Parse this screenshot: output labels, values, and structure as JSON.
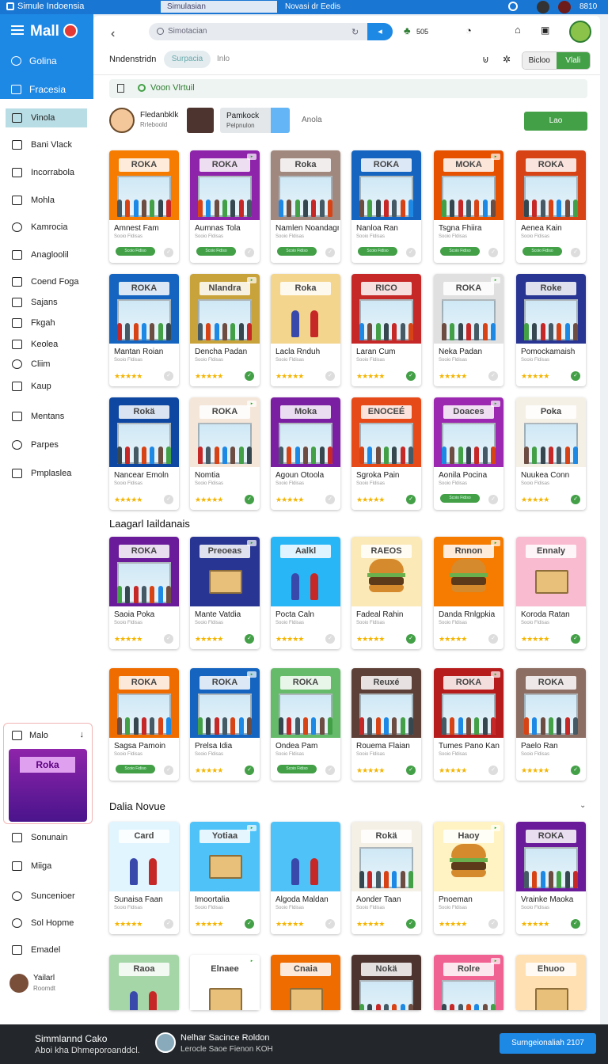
{
  "topbar": {
    "title": "Simule Indoensia",
    "tab_active": "Simulasian",
    "tab_other": "Novasi dr Eedis",
    "value": "8810"
  },
  "sidebar": {
    "logo": "Mall",
    "header_items": [
      "Golina",
      "Fracesia"
    ],
    "items": [
      "Vinola",
      "Bani Vlack",
      "Incorrabola",
      "Mohla",
      "Kamrocia",
      "Anagloolil",
      "Coend Foga",
      "Sajans",
      "Fkgah",
      "Keolea",
      "Cliim",
      "Kaup",
      "Mentans",
      "Parpes",
      "Pmplaslea"
    ],
    "panel_label": "Malo",
    "panel_image_sign": "Roka",
    "items_bottom": [
      "Sonunain",
      "Miiga",
      "Suncenioer",
      "Sol Hopme",
      "Emadel"
    ],
    "user_name": "Yailarl",
    "user_role": "Roomdt"
  },
  "main": {
    "search_placeholder": "Simotacian",
    "top_count": "505",
    "nav_title": "Nndenstridn",
    "nav_chip": "Surpacia",
    "nav_info": "Inlo",
    "seg_left": "Bicloo",
    "seg_right": "Vlali",
    "vbar_text": "Voon Vlrtuil",
    "profile_name": "Fledanbklk",
    "profile_sub": "Rrleboold",
    "box_title": "Pamkock",
    "box_sub": "Pelpnulon",
    "box_label": "Anola",
    "action_button": "Lao",
    "section1": "Laagarl Iaildanais",
    "section2": "Dalia Novue"
  },
  "cards": [
    {
      "title": "Amnest Fam",
      "sign": "ROKA",
      "color": "#f57c00",
      "footer": "pill"
    },
    {
      "title": "Aumnas Tola",
      "sign": "ROKA",
      "color": "#8e24aa",
      "footer": "pill"
    },
    {
      "title": "Namlen Noandagn",
      "sign": "Roka",
      "color": "#a1887f",
      "footer": "pill"
    },
    {
      "title": "Nanloa Ran",
      "sign": "ROKA",
      "color": "#1565c0",
      "footer": "pill"
    },
    {
      "title": "Tsgna Fhiira",
      "sign": "MOKA",
      "color": "#e65100",
      "footer": "pill"
    },
    {
      "title": "Aenea Kain",
      "sign": "ROKA",
      "color": "#d84315",
      "footer": "pill"
    },
    {
      "title": "Mantan Roian",
      "sign": "ROKA",
      "color": "#1565c0",
      "footer": "stars"
    },
    {
      "title": "Dencha Padan",
      "sign": "Nlandra",
      "color": "#c8a23a",
      "footer": "stars"
    },
    {
      "title": "Lacla Rnduh",
      "sign": "Roka",
      "color": "#f4d58d",
      "footer": "stars",
      "kind": "people"
    },
    {
      "title": "Laran Cum",
      "sign": "RICO",
      "color": "#c62828",
      "footer": "stars"
    },
    {
      "title": "Neka Padan",
      "sign": "ROKA",
      "color": "#e0e0e0",
      "footer": "stars"
    },
    {
      "title": "Pomockamaish",
      "sign": "Roke",
      "color": "#283593",
      "footer": "stars"
    },
    {
      "title": "Nancear Emoln",
      "sign": "Rokä",
      "color": "#0d47a1",
      "footer": "stars"
    },
    {
      "title": "Nomtia",
      "sign": "ROKA",
      "color": "#f5e6da",
      "footer": "stars"
    },
    {
      "title": "Agoun Otoola",
      "sign": "Moka",
      "color": "#7b1fa2",
      "footer": "stars"
    },
    {
      "title": "Sgroka Pain",
      "sign": "ENOCEÉ",
      "color": "#e64a19",
      "footer": "stars"
    },
    {
      "title": "Aonila Pocina",
      "sign": "Doaces",
      "color": "#9c27b0",
      "footer": "pill"
    },
    {
      "title": "Nuukea Conn",
      "sign": "Poka",
      "color": "#f5f0e6",
      "footer": "stars"
    },
    {
      "title": "Saoia Poka",
      "sign": "ROKA",
      "color": "#6a1b9a",
      "footer": "stars"
    },
    {
      "title": "Mante Vatdia",
      "sign": "Preoeas",
      "color": "#283593",
      "footer": "stars",
      "kind": "box"
    },
    {
      "title": "Pocta Caln",
      "sign": "Aalkl",
      "color": "#29b6f6",
      "footer": "stars",
      "kind": "people"
    },
    {
      "title": "Fadeal Rahin",
      "sign": "RAEOS",
      "color": "#fbe9b7",
      "footer": "stars",
      "kind": "burger"
    },
    {
      "title": "Danda Rnlgpkia",
      "sign": "Rnnon",
      "color": "#f57c00",
      "footer": "stars",
      "kind": "burger"
    },
    {
      "title": "Koroda Ratan",
      "sign": "Ennaly",
      "color": "#f8bbd0",
      "footer": "stars",
      "kind": "box"
    },
    {
      "title": "Sagsa Pamoin",
      "sign": "ROKA",
      "color": "#ef6c00",
      "footer": "pill"
    },
    {
      "title": "Prelsa Idia",
      "sign": "ROKA",
      "color": "#1565c0",
      "footer": "stars"
    },
    {
      "title": "Ondea Pam",
      "sign": "ROKA",
      "color": "#66bb6a",
      "footer": "pill"
    },
    {
      "title": "Rouema Flaian",
      "sign": "Reuxé",
      "color": "#5d4037",
      "footer": "stars"
    },
    {
      "title": "Tumes Pano Kan",
      "sign": "ROKA",
      "color": "#b71c1c",
      "footer": "stars"
    },
    {
      "title": "Paelo Ran",
      "sign": "ROKA",
      "color": "#8d6e63",
      "footer": "stars"
    },
    {
      "title": "Sunaisa Faan",
      "sign": "Card",
      "color": "#e1f5fe",
      "footer": "stars",
      "kind": "people"
    },
    {
      "title": "Imoortalia",
      "sign": "Yotiaa",
      "color": "#4fc3f7",
      "footer": "stars",
      "kind": "box"
    },
    {
      "title": "Algoda Maldan",
      "sign": "",
      "color": "#4fc3f7",
      "footer": "stars",
      "kind": "people"
    },
    {
      "title": "Aonder Taan",
      "sign": "Rokä",
      "color": "#f5f0e6",
      "footer": "stars"
    },
    {
      "title": "Pnoeman",
      "sign": "Haoy",
      "color": "#fff3c4",
      "footer": "stars",
      "kind": "burger"
    },
    {
      "title": "Vrainke Maoka",
      "sign": "ROKA",
      "color": "#6a1b9a",
      "footer": "stars"
    },
    {
      "title": "",
      "sign": "Raoa",
      "color": "#a5d6a7",
      "footer": "none",
      "kind": "people"
    },
    {
      "title": "",
      "sign": "Elnaee",
      "color": "#ffffff",
      "footer": "none",
      "kind": "box"
    },
    {
      "title": "",
      "sign": "Cnaia",
      "color": "#ef6c00",
      "footer": "none",
      "kind": "box"
    },
    {
      "title": "",
      "sign": "Nokä",
      "color": "#4e342e",
      "footer": "none"
    },
    {
      "title": "",
      "sign": "Rolre",
      "color": "#f06292",
      "footer": "none"
    },
    {
      "title": "",
      "sign": "Ehuoo",
      "color": "#ffe0b2",
      "footer": "none",
      "kind": "box"
    }
  ],
  "card_subtitle": "Sooio Fldisas",
  "card_pill": "Scoio Fidiso",
  "card_stars": "★★★★★",
  "bottombar": {
    "line1": "Simmlannd Cako",
    "line2": "Aboi kha Dhmeporoanddcl.",
    "mid1": "Nelhar Sacince Roldon",
    "mid2": "Lerocle Saoe Fienon KOH",
    "button": "Surngeionaliah 2107"
  }
}
